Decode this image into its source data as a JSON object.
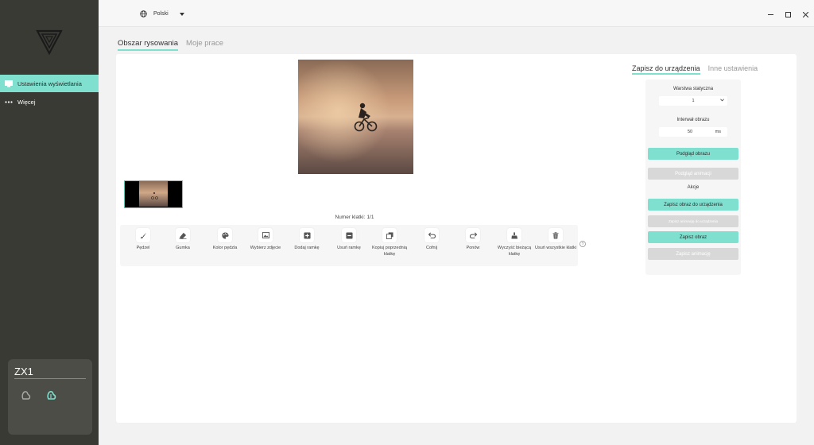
{
  "sidebar": {
    "items": [
      {
        "label": "Ustawienia wyświetlania",
        "icon": "monitor-icon",
        "active": true
      },
      {
        "label": "Więcej",
        "icon": "more-icon",
        "active": false
      }
    ],
    "device": {
      "name": "ZX1"
    }
  },
  "titlebar": {
    "language": "Polski"
  },
  "tabs": [
    {
      "label": "Obszar rysowania",
      "active": true
    },
    {
      "label": "Moje prace",
      "active": false
    }
  ],
  "canvas": {
    "frame_label": "Numer klatki:",
    "frame_value": "1/1"
  },
  "tools": [
    {
      "label": "Pędzel",
      "icon": "brush-icon"
    },
    {
      "label": "Gumka",
      "icon": "eraser-icon"
    },
    {
      "label": "Kolor pędzla",
      "icon": "palette-icon"
    },
    {
      "label": "Wybierz zdjęcie",
      "icon": "image-icon"
    },
    {
      "label": "Dodaj ramkę",
      "icon": "plus-square-icon"
    },
    {
      "label": "Usuń ramkę",
      "icon": "minus-square-icon"
    },
    {
      "label": "Kopiuj poprzednią klatkę",
      "icon": "copy-icon"
    },
    {
      "label": "Cofnij",
      "icon": "undo-icon"
    },
    {
      "label": "Ponów",
      "icon": "redo-icon"
    },
    {
      "label": "Wyczyść bieżącą klatkę",
      "icon": "clear-icon"
    },
    {
      "label": "Usuń wszystkie klatki",
      "icon": "trash-icon"
    }
  ],
  "settings": {
    "tabs": [
      {
        "label": "Zapisz do urządzenia",
        "active": true
      },
      {
        "label": "Inne ustawienia",
        "active": false
      }
    ],
    "static_layer_label": "Warstwa statyczna",
    "static_layer_value": "1",
    "interval_label": "Interwał obrazu",
    "interval_value": "50",
    "interval_unit": "ms",
    "preview_image": "Podgląd obrazu",
    "preview_animation": "Podgląd animacji",
    "actions_label": "Akcje",
    "save_image_device": "Zapisz obraz do urządzenia",
    "save_animation_device": "Zapisz animację do urządzenia",
    "save_image": "Zapisz obraz",
    "save_animation": "Zapisz animację"
  },
  "colors": {
    "accent": "#7fe0cf",
    "sidebar": "#3a3a35",
    "disabled": "#d8d8d8"
  }
}
